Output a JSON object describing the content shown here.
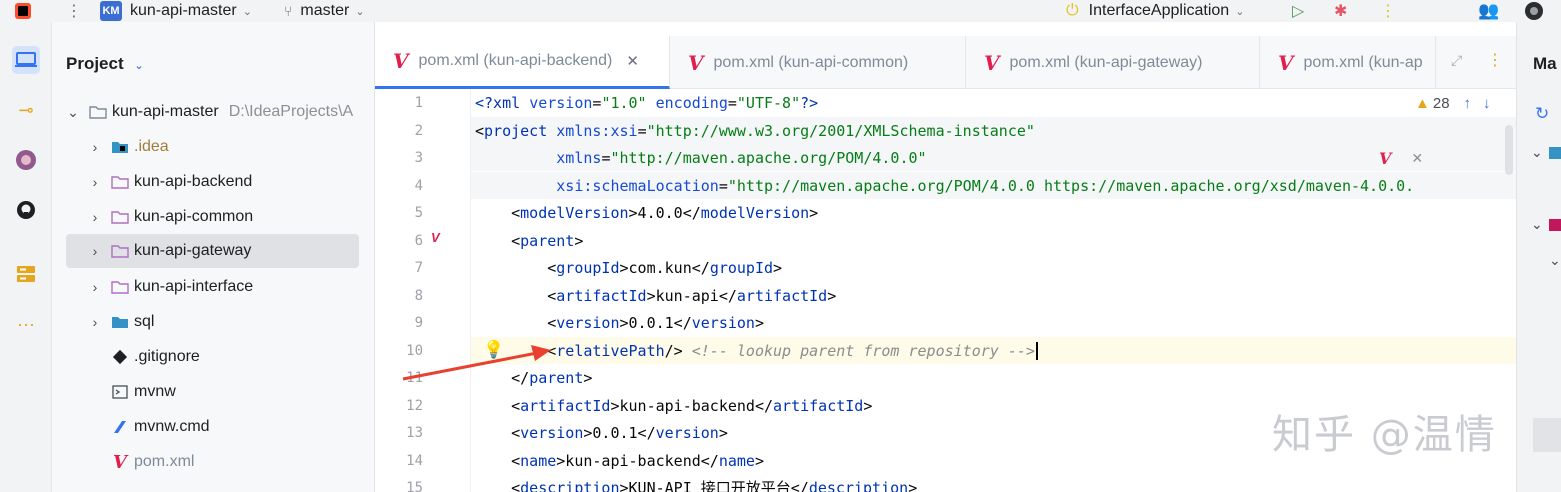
{
  "topbar": {
    "project_badge": "KM",
    "project_name": "kun-api-master",
    "branch": "master",
    "run_config": "InterfaceApplication"
  },
  "project_panel": {
    "title": "Project",
    "tree": [
      {
        "label": "kun-api-master",
        "path": "D:\\IdeaProjects\\A",
        "kind": "folder",
        "expanded": true
      },
      {
        "label": ".idea",
        "kind": "idea-folder"
      },
      {
        "label": "kun-api-backend",
        "kind": "module"
      },
      {
        "label": "kun-api-common",
        "kind": "module"
      },
      {
        "label": "kun-api-gateway",
        "kind": "module",
        "selected": true
      },
      {
        "label": "kun-api-interface",
        "kind": "module"
      },
      {
        "label": "sql",
        "kind": "folder"
      },
      {
        "label": ".gitignore",
        "kind": "file"
      },
      {
        "label": "mvnw",
        "kind": "file"
      },
      {
        "label": "mvnw.cmd",
        "kind": "file"
      },
      {
        "label": "pom.xml",
        "kind": "maven"
      }
    ]
  },
  "tabs": [
    {
      "label": "pom.xml (kun-api-backend)",
      "active": true
    },
    {
      "label": "pom.xml (kun-api-common)",
      "active": false
    },
    {
      "label": "pom.xml (kun-api-gateway)",
      "active": false
    },
    {
      "label": "pom.xml (kun-ap",
      "active": false
    }
  ],
  "right_panel_label": "Ma",
  "inspection": {
    "warnings": "28"
  },
  "editor": {
    "lines": [
      {
        "n": "1",
        "segments": [
          [
            "tag",
            "<?xml "
          ],
          [
            "attr",
            "version"
          ],
          [
            "txt",
            "="
          ],
          [
            "str",
            "\"1.0\""
          ],
          [
            "txt",
            " "
          ],
          [
            "attr",
            "encoding"
          ],
          [
            "txt",
            "="
          ],
          [
            "str",
            "\"UTF-8\""
          ],
          [
            "tag",
            "?>"
          ]
        ]
      },
      {
        "n": "2",
        "segments": [
          [
            "txt",
            "<"
          ],
          [
            "tag",
            "project "
          ],
          [
            "attr",
            "xmlns:xsi"
          ],
          [
            "txt",
            "="
          ],
          [
            "str",
            "\"http://www.w3.org/2001/XMLSchema-instance\""
          ]
        ]
      },
      {
        "n": "3",
        "segments": [
          [
            "txt",
            "         "
          ],
          [
            "attr",
            "xmlns"
          ],
          [
            "txt",
            "="
          ],
          [
            "str",
            "\"http://maven.apache.org/POM/4.0.0\""
          ]
        ]
      },
      {
        "n": "4",
        "segments": [
          [
            "txt",
            "         "
          ],
          [
            "attr",
            "xsi:schemaLocation"
          ],
          [
            "txt",
            "="
          ],
          [
            "str",
            "\"http://maven.apache.org/POM/4.0.0 https://maven.apache.org/xsd/maven-4.0.0."
          ]
        ]
      },
      {
        "n": "5",
        "segments": [
          [
            "txt",
            "    <"
          ],
          [
            "tag",
            "modelVersion"
          ],
          [
            "txt",
            ">4.0.0</"
          ],
          [
            "tag",
            "modelVersion"
          ],
          [
            "txt",
            ">"
          ]
        ]
      },
      {
        "n": "6",
        "segments": [
          [
            "txt",
            "    <"
          ],
          [
            "tag",
            "parent"
          ],
          [
            "txt",
            ">"
          ]
        ]
      },
      {
        "n": "7",
        "segments": [
          [
            "txt",
            "        <"
          ],
          [
            "tag",
            "groupId"
          ],
          [
            "txt",
            ">com.kun</"
          ],
          [
            "tag",
            "groupId"
          ],
          [
            "txt",
            ">"
          ]
        ]
      },
      {
        "n": "8",
        "segments": [
          [
            "txt",
            "        <"
          ],
          [
            "tag",
            "artifactId"
          ],
          [
            "txt",
            ">kun-api</"
          ],
          [
            "tag",
            "artifactId"
          ],
          [
            "txt",
            ">"
          ]
        ]
      },
      {
        "n": "9",
        "segments": [
          [
            "txt",
            "        <"
          ],
          [
            "tag",
            "version"
          ],
          [
            "txt",
            ">0.0.1</"
          ],
          [
            "tag",
            "version"
          ],
          [
            "txt",
            ">"
          ]
        ]
      },
      {
        "n": "10",
        "segments": [
          [
            "txt",
            "        <"
          ],
          [
            "tag",
            "relativePath"
          ],
          [
            "txt",
            "/> "
          ],
          [
            "cmt",
            "<!-- lookup parent from repository -->"
          ]
        ]
      },
      {
        "n": "11",
        "segments": [
          [
            "txt",
            "    </"
          ],
          [
            "tag",
            "parent"
          ],
          [
            "txt",
            ">"
          ]
        ]
      },
      {
        "n": "12",
        "segments": [
          [
            "txt",
            "    <"
          ],
          [
            "tag",
            "artifactId"
          ],
          [
            "txt",
            ">kun-api-backend</"
          ],
          [
            "tag",
            "artifactId"
          ],
          [
            "txt",
            ">"
          ]
        ]
      },
      {
        "n": "13",
        "segments": [
          [
            "txt",
            "    <"
          ],
          [
            "tag",
            "version"
          ],
          [
            "txt",
            ">0.0.1</"
          ],
          [
            "tag",
            "version"
          ],
          [
            "txt",
            ">"
          ]
        ]
      },
      {
        "n": "14",
        "segments": [
          [
            "txt",
            "    <"
          ],
          [
            "tag",
            "name"
          ],
          [
            "txt",
            ">kun-api-backend</"
          ],
          [
            "tag",
            "name"
          ],
          [
            "txt",
            ">"
          ]
        ]
      },
      {
        "n": "15",
        "segments": [
          [
            "txt",
            "    <"
          ],
          [
            "tag",
            "description"
          ],
          [
            "txt",
            ">KUN-API 接口开放平台</"
          ],
          [
            "tag",
            "description"
          ],
          [
            "txt",
            ">"
          ]
        ]
      }
    ]
  },
  "watermark": "知乎 @温情",
  "colors": {
    "accent": "#3574f0",
    "maven_red": "#e01f4e",
    "current_line": "#fefbe8",
    "warning": "#e5c01c"
  }
}
